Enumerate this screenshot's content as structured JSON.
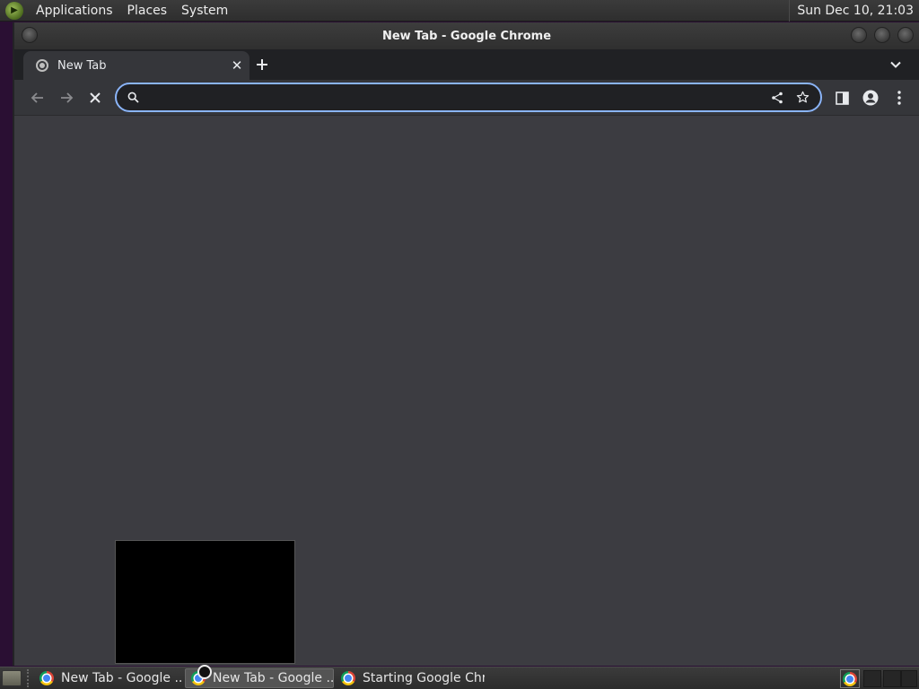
{
  "top_panel": {
    "menus": [
      "Applications",
      "Places",
      "System"
    ],
    "clock": "Sun Dec 10, 21:03"
  },
  "window": {
    "title": "New Tab - Google Chrome"
  },
  "tabs": [
    {
      "title": "New Tab",
      "active": true
    }
  ],
  "toolbar": {
    "back_icon": "arrow-left-icon",
    "forward_icon": "arrow-right-icon",
    "stop_icon": "close-icon",
    "omnibox_value": "",
    "omnibox_placeholder": "",
    "omnibox_accent": "#8ab4f8"
  },
  "taskbar": {
    "tasks": [
      {
        "label": "New Tab - Google ...",
        "active": false
      },
      {
        "label": "New Tab - Google ...",
        "active": true
      },
      {
        "label": "Starting Google Chr...",
        "active": false
      }
    ]
  },
  "colors": {
    "chrome_dark": "#202124",
    "chrome_toolbar": "#35363a",
    "page_bg": "#3c3c41"
  }
}
